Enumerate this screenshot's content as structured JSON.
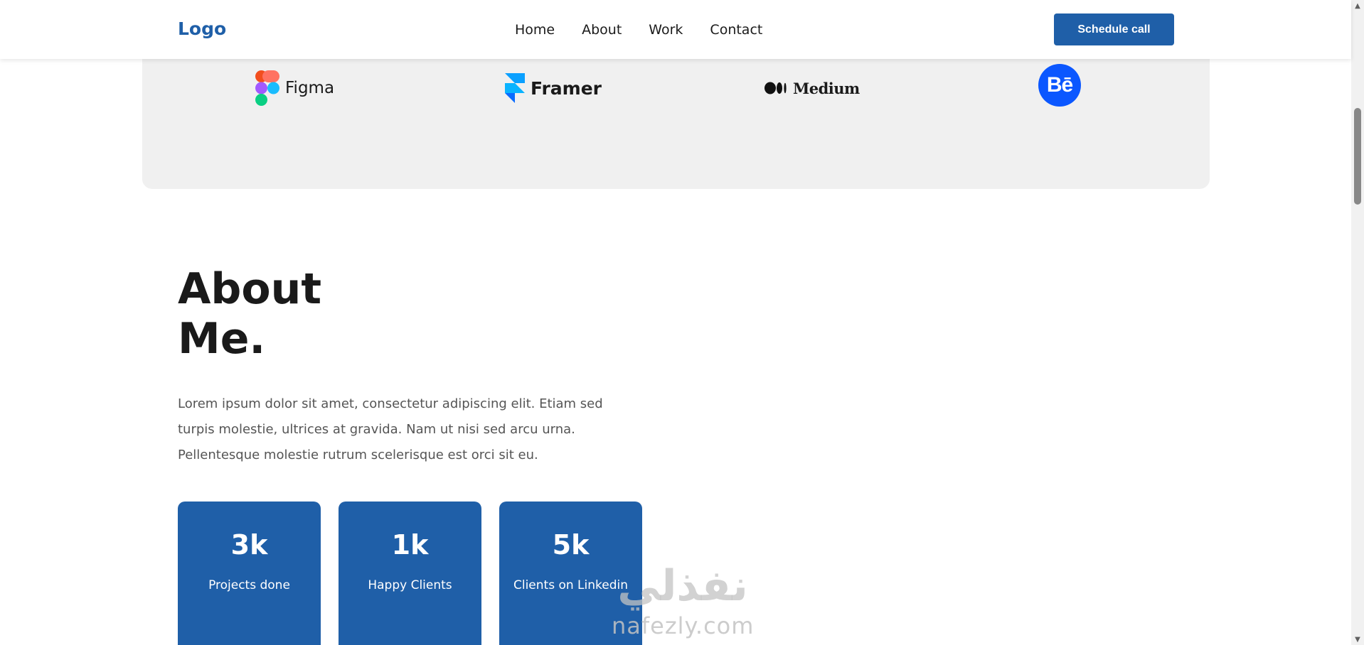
{
  "header": {
    "logo": "Logo",
    "nav": [
      "Home",
      "About",
      "Work",
      "Contact"
    ],
    "cta_label": "Schedule call"
  },
  "partners": [
    {
      "name": "Figma",
      "icon": "figma-logo-icon"
    },
    {
      "name": "Framer",
      "icon": "framer-logo-icon"
    },
    {
      "name": "Medium",
      "icon": "medium-logo-icon"
    },
    {
      "name": "Bē",
      "icon": "behance-logo-icon"
    }
  ],
  "about": {
    "title_line1": "About",
    "title_line2": "Me.",
    "text": "Lorem ipsum dolor sit amet, consectetur adipiscing elit. Etiam sed turpis molestie, ultrices at gravida. Nam ut nisi sed arcu urna. Pellentesque molestie rutrum scelerisque est orci sit eu.",
    "stats": [
      {
        "value": "3k",
        "label": "Projects done"
      },
      {
        "value": "1k",
        "label": "Happy Clients"
      },
      {
        "value": "5k",
        "label": "Clients on Linkedin"
      }
    ]
  },
  "watermark": {
    "arabic": "نفذلي",
    "latin": "nafezly.com"
  },
  "colors": {
    "brand_blue": "#1f5fa8",
    "behance_blue": "#0b57ff",
    "strip_gray": "#f0f0f0"
  }
}
